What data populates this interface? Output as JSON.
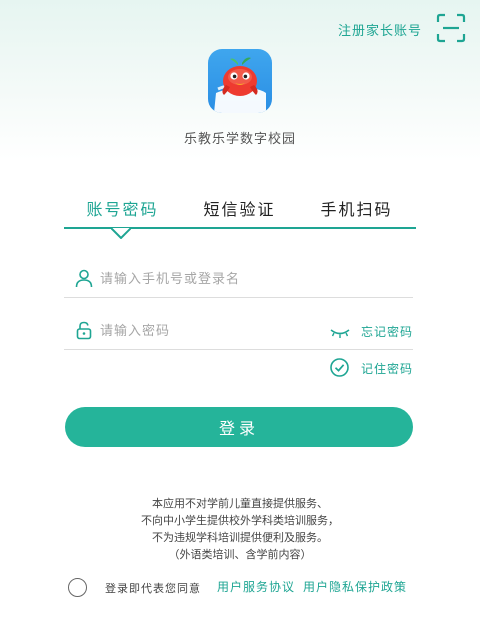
{
  "header": {
    "register_parent_label": "注册家长账号",
    "scan_icon": "scan-frame-icon"
  },
  "app": {
    "name": "乐教乐学数字校园",
    "logo_icon": "red-bird-mascot-icon",
    "accent_color": "#1ea593"
  },
  "tabs": [
    {
      "label": "账号密码",
      "active": true
    },
    {
      "label": "短信验证",
      "active": false
    },
    {
      "label": "手机扫码",
      "active": false
    }
  ],
  "form": {
    "username_placeholder": "请输入手机号或登录名",
    "username_icon": "user-icon",
    "password_placeholder": "请输入密码",
    "password_icon": "lock-icon",
    "eye_icon": "eye-closed-icon",
    "forgot_label": "忘记密码",
    "remember_label": "记住密码",
    "remember_checked": true,
    "login_label": "登录"
  },
  "notice": {
    "lines": [
      "本应用不对学前儿童直接提供服务、",
      "不向中小学生提供校外学科类培训服务，",
      "不为违规学科培训提供便利及服务。",
      "（外语类培训、含学前内容）"
    ]
  },
  "agreement": {
    "prefix": "登录即代表您同意",
    "service_link": "用户服务协议",
    "privacy_link": "用户隐私保护政策",
    "agreed": false
  }
}
